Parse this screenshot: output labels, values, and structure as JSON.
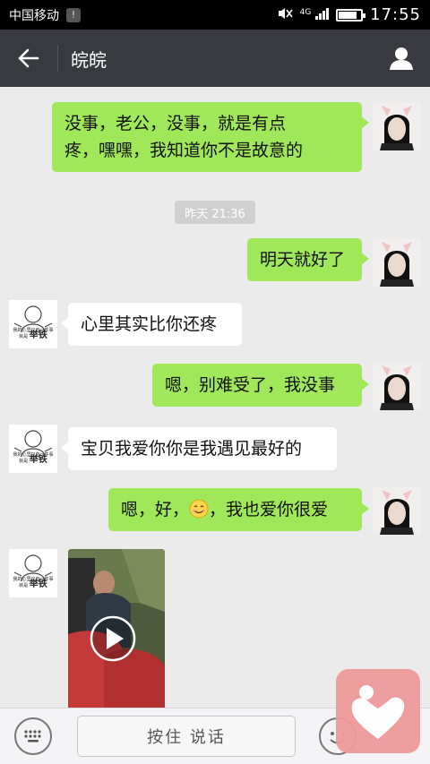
{
  "status_bar": {
    "carrier": "中国移动",
    "notification_count": "!",
    "network": "4G",
    "battery_level": 0.75,
    "time": "17:55"
  },
  "nav": {
    "title": "皖皖",
    "back_icon": "arrow-left-icon",
    "profile_icon": "person-icon"
  },
  "messages": [
    {
      "sender": "me",
      "text_line1": "没事，老公，没事，就是有点",
      "text_line2": "疼，嘿嘿，我知道你不是故意的"
    },
    {
      "sender": "me",
      "text": "明天就好了"
    },
    {
      "sender": "other",
      "text": "心里其实比你还疼"
    },
    {
      "sender": "me",
      "text": "嗯，别难受了，我没事"
    },
    {
      "sender": "other",
      "text": "宝贝我爱你你是我遇见最好的"
    },
    {
      "sender": "me",
      "text_before_emoji": "嗯，好，",
      "emoji": "smile-emoji",
      "text_after_emoji": "，我也爱你很爱"
    },
    {
      "sender": "other",
      "type": "video"
    }
  ],
  "timestamp": "昨天 21:36",
  "other_avatar_caption": "我的心里只有一件事",
  "other_avatar_caption2": "就是",
  "other_avatar_name": "举铁",
  "input_bar": {
    "hold_to_talk": "按住 说话",
    "keyboard_icon": "keyboard-icon",
    "emoji_icon": "emoji-icon"
  },
  "colors": {
    "nav_bg": "#393a3f",
    "chat_bg": "#ebebeb",
    "my_bubble": "#a0e75a",
    "other_bubble": "#ffffff",
    "float_widget": "#ef9a9a"
  }
}
